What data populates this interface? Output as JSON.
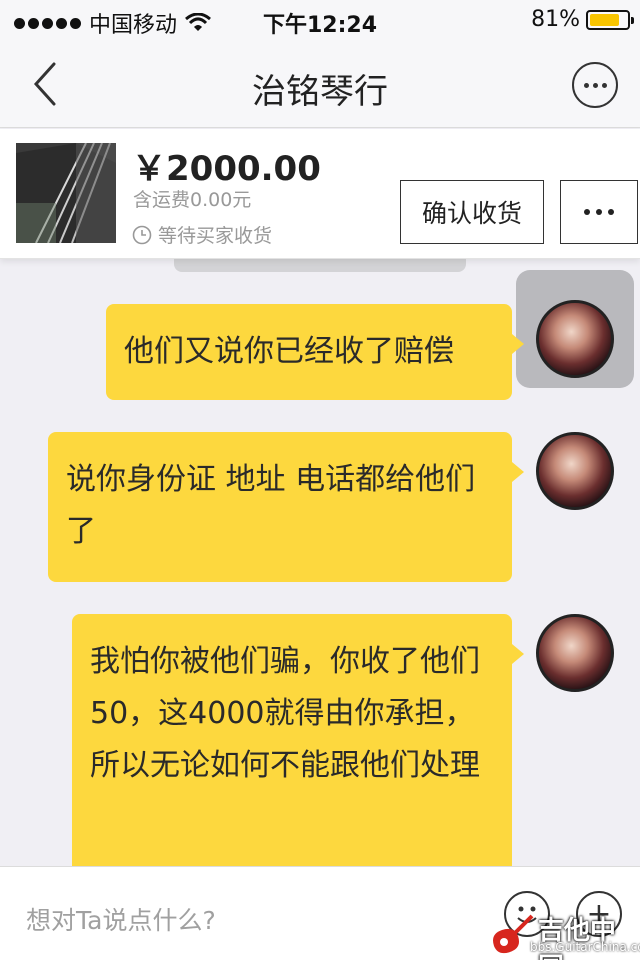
{
  "status_bar": {
    "carrier": "中国移动",
    "time": "下午12:24",
    "battery": "81%",
    "battery_level": 0.81,
    "wifi_icon": "wifi-icon"
  },
  "nav": {
    "title": "治铭琴行",
    "back_icon": "chevron-left-icon",
    "more_icon": "more-circle-icon"
  },
  "product": {
    "price": "￥2000.00",
    "shipping": "含运费0.00元",
    "status": "等待买家收货",
    "confirm_label": "确认收货"
  },
  "messages": [
    {
      "text": "他们又说你已经收了赔偿"
    },
    {
      "text": "说你身份证 地址 电话都给他们了"
    },
    {
      "text": "我怕你被他们骗，你收了他们50，这4000就得由你承担，所以无论如何不能跟他们处理"
    }
  ],
  "input": {
    "placeholder": "想对Ta说点什么?"
  },
  "watermark": {
    "title": "吉他中国",
    "subtitle": "bbs.GuitarChina.com"
  },
  "colors": {
    "bubble": "#fdd83e",
    "background": "#f0eff4",
    "battery": "#f7c400"
  }
}
